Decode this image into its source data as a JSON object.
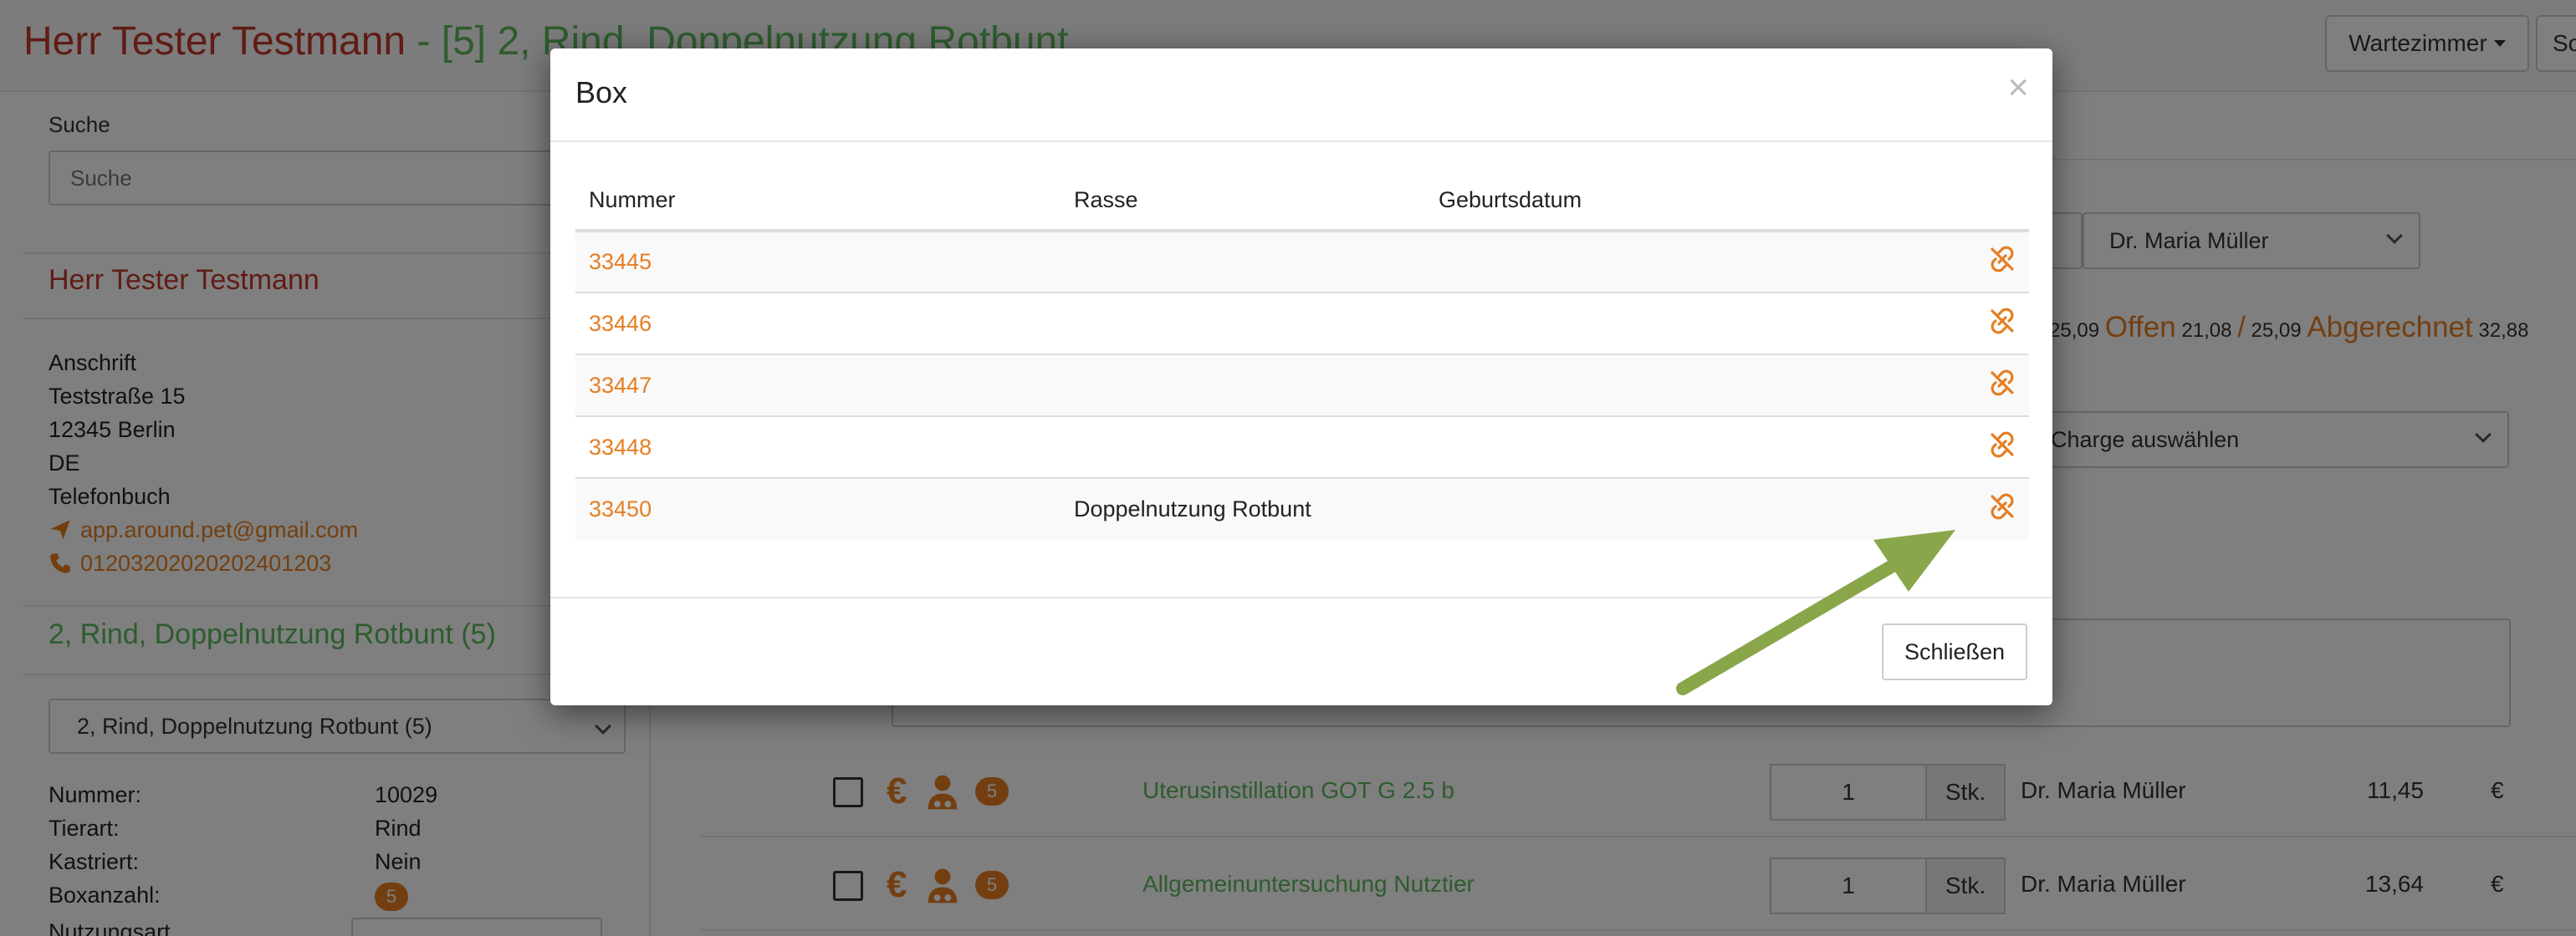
{
  "header": {
    "owner": "Herr Tester Testmann",
    "separator": " - ",
    "animal": "[5] 2, Rind, Doppelnutzung Rotbunt",
    "wartezimmer_label": "Wartezimmer",
    "so_label": "So"
  },
  "sidebar": {
    "search_label": "Suche",
    "search_placeholder": "Suche",
    "owner_name": "Herr Tester Testmann",
    "address": {
      "label": "Anschrift",
      "street": "Teststraße 15",
      "city": "12345  Berlin",
      "country": "DE",
      "phonebook": "Telefonbuch",
      "email": "app.around.pet@gmail.com",
      "phone": "01203202020202401203"
    },
    "animal_heading": "2, Rind, Doppelnutzung Rotbunt (5)",
    "animal_select": "2, Rind, Doppelnutzung Rotbunt (5)",
    "details": [
      {
        "label": "Nummer:",
        "value": "10029"
      },
      {
        "label": "Tierart:",
        "value": "Rind"
      },
      {
        "label": "Kastriert:",
        "value": "Nein"
      },
      {
        "label": "Boxanzahl:",
        "value": "5"
      },
      {
        "label": "Nutzungsart",
        "value": ""
      }
    ]
  },
  "main": {
    "doctor_select": "Dr. Maria Müller",
    "totals": {
      "value_a": "25,09",
      "open_label": "Offen",
      "open_value": "21,08",
      "slash": "/",
      "open_total": "25,09",
      "billed_label": "Abgerechnet",
      "billed_value": "32,88"
    },
    "charge_select": "Charge auswählen",
    "services": [
      {
        "badge": "5",
        "name": "Uterusinstillation GOT G 2.5 b",
        "qty": "1",
        "unit": "Stk.",
        "doctor": "Dr. Maria Müller",
        "price": "11,45",
        "currency": "€"
      },
      {
        "badge": "5",
        "name": "Allgemeinuntersuchung Nutztier",
        "qty": "1",
        "unit": "Stk.",
        "doctor": "Dr. Maria Müller",
        "price": "13,64",
        "currency": "€"
      }
    ]
  },
  "modal": {
    "title": "Box",
    "close_symbol": "×",
    "columns": [
      "Nummer",
      "Rasse",
      "Geburtsdatum"
    ],
    "rows": [
      {
        "nummer": "33445",
        "rasse": "",
        "geburtsdatum": ""
      },
      {
        "nummer": "33446",
        "rasse": "",
        "geburtsdatum": ""
      },
      {
        "nummer": "33447",
        "rasse": "",
        "geburtsdatum": ""
      },
      {
        "nummer": "33448",
        "rasse": "",
        "geburtsdatum": ""
      },
      {
        "nummer": "33450",
        "rasse": "Doppelnutzung Rotbunt",
        "geburtsdatum": ""
      }
    ],
    "close_button": "Schließen"
  },
  "icons": {
    "unlink": "unlink-icon",
    "arrow_color": "#8aa64a",
    "accent": "#e67e22",
    "owner_color": "#c0392b",
    "animal_color": "#5cb85c"
  }
}
